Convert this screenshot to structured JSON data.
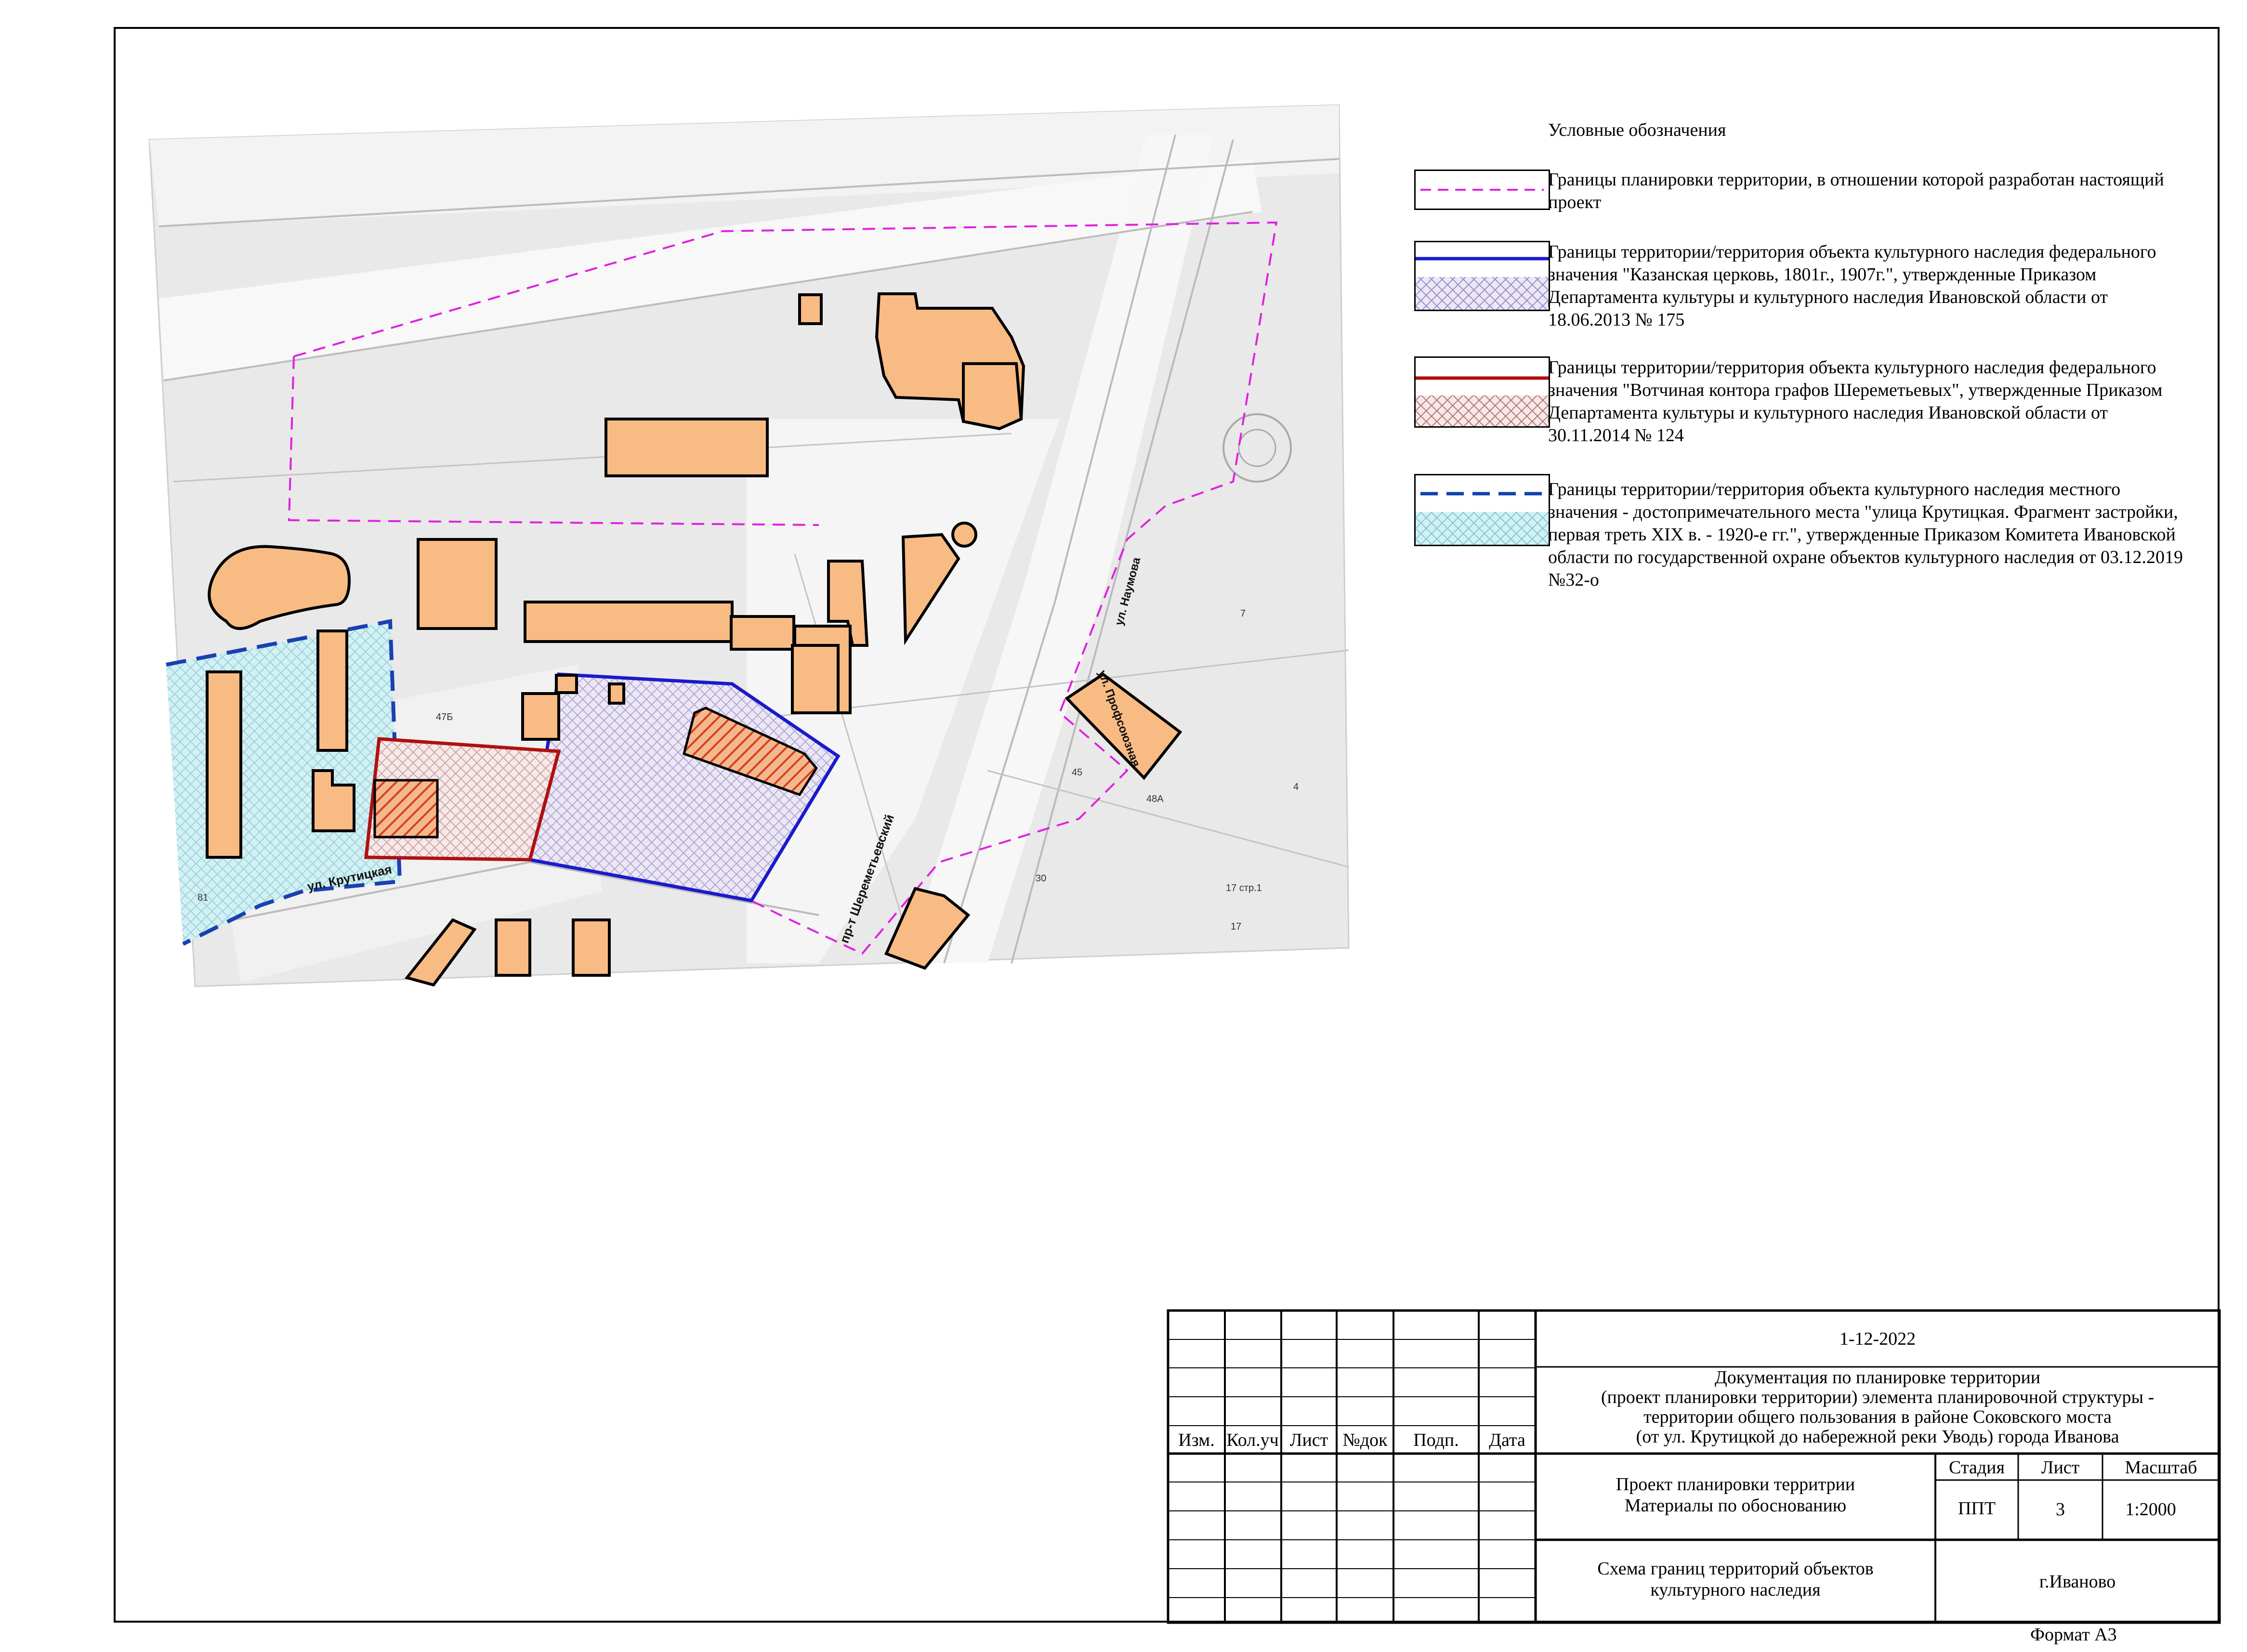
{
  "legend": {
    "title": "Условные обозначения",
    "items": [
      {
        "text": "Границы планировки территории, в отношении которой разработан настоящий проект",
        "color": "#e020e0"
      },
      {
        "text": "Границы территории/территория объекта культурного наследия федерального значения \"Казанская церковь, 1801г., 1907г.\", утвержденные Приказом Департамента культуры и культурного наследия Ивановской области от 18.06.2013 № 175",
        "color": "#1a1acc"
      },
      {
        "text": "Границы территории/территория объекта культурного наследия федерального значения \"Вотчиная контора графов Шереметьевых\", утвержденные Приказом Департамента культуры и культурного наследия Ивановской области от 30.11.2014 № 124",
        "color": "#b01010"
      },
      {
        "text": "Границы территории/территория объекта культурного наследия местного значения - достопримечательного места \"улица Крутицкая. Фрагмент застройки, первая треть XIX в. - 1920-е гг.\", утвержденные Приказом Комитета Ивановской области по государственной охране объектов культурного наследия от 03.12.2019 №32-о",
        "color": "#1040b0"
      }
    ]
  },
  "map_labels": {
    "street_krutitskaya": "ул. Крутицкая",
    "street_sheremetev": "пр-т Шереметьевский",
    "street_naumova": "ул. Наумова",
    "street_profsoyuznaya": "ул. Профсоюзная",
    "house_47b": "47Б",
    "house_7": "7",
    "house_4": "4",
    "house_45": "45",
    "house_48a": "48А",
    "house_30": "30",
    "house_17str1": "17 стр.1",
    "house_17": "17",
    "house_81": "81"
  },
  "title_block": {
    "columns": [
      "Изм.",
      "Кол.уч",
      "Лист",
      "№док",
      "Подп.",
      "Дата"
    ],
    "code": "1-12-2022",
    "doc_lines": [
      "Документация по планировке территории",
      "(проект планировки территории) элемента планировочной структуры -",
      "территории общего пользования в районе Соковского моста",
      "(от ул. Крутицкой до набережной реки Уводь) города Иванова"
    ],
    "project_lines": [
      "Проект планировки территрии",
      "Материалы по обоснованию"
    ],
    "stage_header": "Стадия",
    "sheet_header": "Лист",
    "scale_header": "Масштаб",
    "stage": "ППТ",
    "sheet": "3",
    "scale": "1:2000",
    "drawing_lines": [
      "Схема границ территорий объектов",
      "культурного наследия"
    ],
    "city": "г.Иваново"
  },
  "format_label": "Формат А3"
}
